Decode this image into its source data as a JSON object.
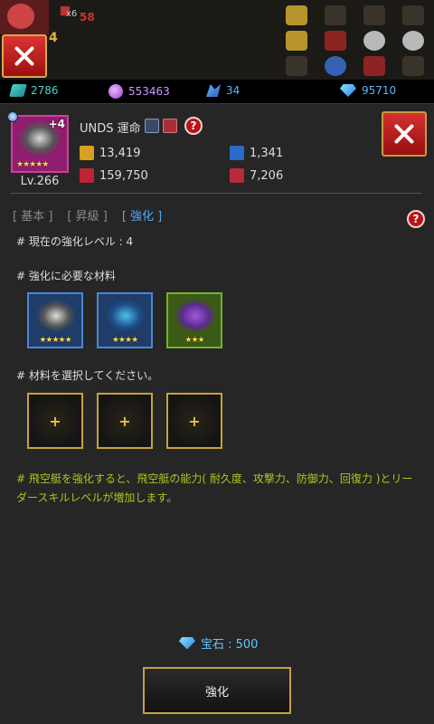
{
  "hud": {
    "item_count": "x6",
    "red_count": "58",
    "player_level": "4"
  },
  "resources": {
    "stone": "2786",
    "orb": "553463",
    "wing": "34",
    "gem": "95710"
  },
  "ship": {
    "name": "UNDS 運命",
    "plus": "+4",
    "stars": "★★★★★",
    "level": "Lv.266",
    "stats": {
      "flight": "13,419",
      "hp": "159,750",
      "defense": "1,341",
      "attack": "7,206"
    }
  },
  "tabs": {
    "basic": "[ 基本 ]",
    "promote": "[ 昇級 ]",
    "enhance": "[ 強化 ]"
  },
  "help_glyph": "?",
  "labels": {
    "current_level": "# 現在の強化レベル : 4",
    "required": "# 強化に必要な材料",
    "select": "# 材料を選択してください。",
    "note": "# 飛空艇を強化すると、飛空艇の能力( 耐久度、攻撃力、防御力、回復力 )とリーダースキルレベルが増加します。",
    "cost": "宝石 : 500",
    "enhance_button": "強化"
  },
  "materials": [
    {
      "stars": "★★★★★"
    },
    {
      "stars": "★★★★"
    },
    {
      "stars": "★★★"
    }
  ],
  "empty_slot_glyph": "+",
  "colors": {
    "accent_tab": "#52a8ff",
    "note_text": "#a8c81e",
    "cost_text": "#62c8ff",
    "close_red": "#c82020",
    "gold_border": "#c9a23a"
  }
}
